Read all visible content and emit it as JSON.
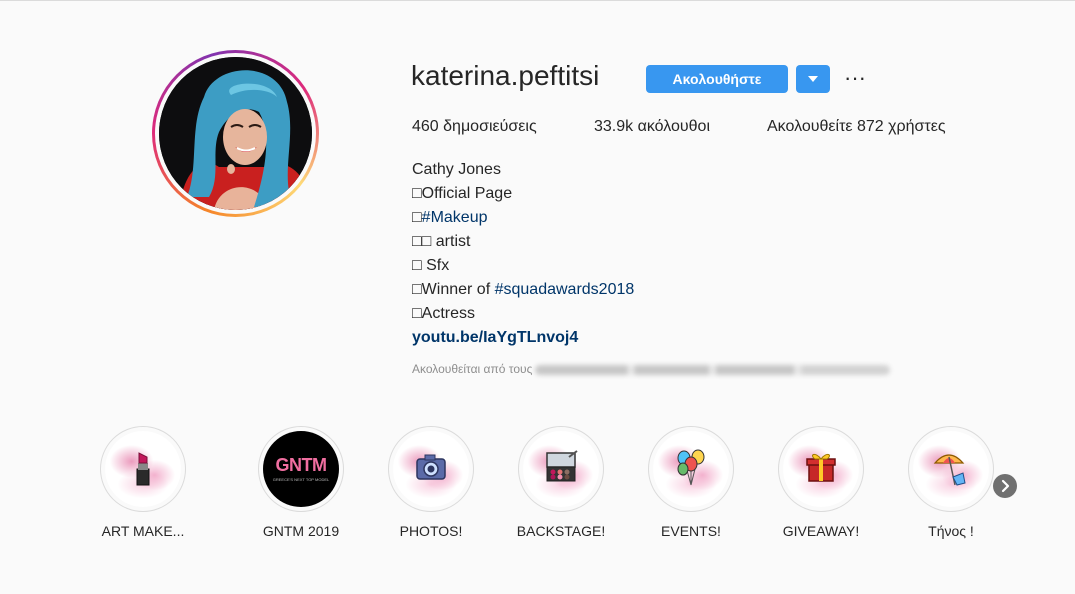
{
  "profile": {
    "username": "katerina.peftitsi",
    "follow_label": "Ακολουθήστε",
    "more_label": "···"
  },
  "stats": {
    "posts": "460 δημοσιεύσεις",
    "followers": "33.9k ακόλουθοι",
    "following": "Ακολουθείτε 872 χρήστες"
  },
  "bio": {
    "name": "Cathy Jones",
    "lines": [
      {
        "prefix": "□",
        "text": "Official Page"
      },
      {
        "prefix": "□",
        "text": "#Makeup"
      },
      {
        "prefix": "□□ ",
        "text": "artist"
      },
      {
        "prefix": "□ ",
        "text": "Sfx"
      },
      {
        "prefix": "□",
        "text": "Winner of ",
        "link": "#squadawards2018"
      },
      {
        "prefix": "□",
        "text": "Actress"
      }
    ],
    "website": "youtu.be/IaYgTLnvoj4",
    "followed_by": "Ακολουθείται από τους"
  },
  "highlights": [
    {
      "label": "ART MAKE...",
      "icon": "lipstick-icon"
    },
    {
      "label": "GNTM 2019",
      "icon": "gntm-logo",
      "logo_text": "GNTM",
      "logo_sub": "GREECE'S NEXT TOP MODEL"
    },
    {
      "label": "PHOTOS!",
      "icon": "camera-icon"
    },
    {
      "label": "BACKSTAGE!",
      "icon": "makeup-palette-icon"
    },
    {
      "label": "EVENTS!",
      "icon": "balloons-icon"
    },
    {
      "label": "GIVEAWAY!",
      "icon": "gift-icon"
    },
    {
      "label": "Τήνος !",
      "icon": "beach-umbrella-icon"
    }
  ],
  "colors": {
    "accent": "#3897f0",
    "link": "#003569",
    "text": "#262626",
    "muted": "#8e8e8e"
  }
}
